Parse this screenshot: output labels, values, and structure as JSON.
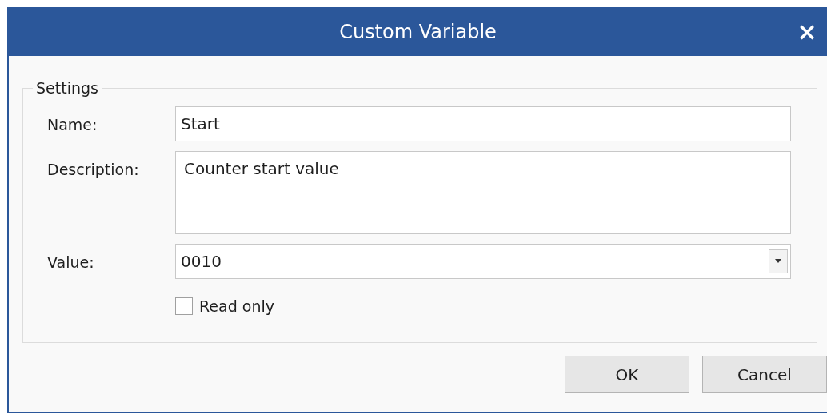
{
  "window": {
    "title": "Custom Variable",
    "close": "×"
  },
  "group": {
    "legend": "Settings"
  },
  "fields": [
    {
      "kind": "text",
      "label": "Name:",
      "value": "Start"
    },
    {
      "kind": "multiline",
      "label": "Description:",
      "value": "Counter start value"
    },
    {
      "kind": "combo",
      "label": "Value:",
      "value": "0010"
    }
  ],
  "read_only": {
    "label": "Read only",
    "checked": false
  },
  "buttons": [
    "OK",
    "Cancel"
  ]
}
